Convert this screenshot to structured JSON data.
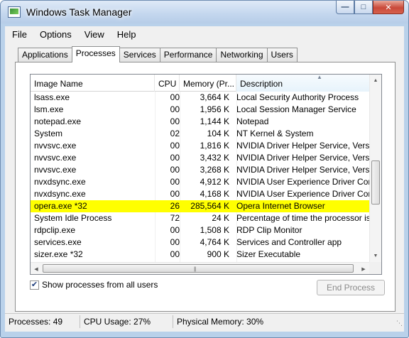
{
  "window": {
    "title": "Windows Task Manager"
  },
  "menu": [
    "File",
    "Options",
    "View",
    "Help"
  ],
  "tabs": [
    "Applications",
    "Processes",
    "Services",
    "Performance",
    "Networking",
    "Users"
  ],
  "active_tab": "Processes",
  "columns": {
    "image_name": "Image Name",
    "cpu": "CPU",
    "memory": "Memory (Pr...",
    "description": "Description"
  },
  "processes": [
    {
      "name": "lsass.exe",
      "cpu": "00",
      "memory": "3,664 K",
      "description": "Local Security Authority Process"
    },
    {
      "name": "lsm.exe",
      "cpu": "00",
      "memory": "1,956 K",
      "description": "Local Session Manager Service"
    },
    {
      "name": "notepad.exe",
      "cpu": "00",
      "memory": "1,144 K",
      "description": "Notepad"
    },
    {
      "name": "System",
      "cpu": "02",
      "memory": "104 K",
      "description": "NT Kernel & System"
    },
    {
      "name": "nvvsvc.exe",
      "cpu": "00",
      "memory": "1,816 K",
      "description": "NVIDIA Driver Helper Service, Version ..."
    },
    {
      "name": "nvvsvc.exe",
      "cpu": "00",
      "memory": "3,432 K",
      "description": "NVIDIA Driver Helper Service, Version ..."
    },
    {
      "name": "nvvsvc.exe",
      "cpu": "00",
      "memory": "3,268 K",
      "description": "NVIDIA Driver Helper Service, Version ..."
    },
    {
      "name": "nvxdsync.exe",
      "cpu": "00",
      "memory": "4,912 K",
      "description": "NVIDIA User Experience Driver Compo..."
    },
    {
      "name": "nvxdsync.exe",
      "cpu": "00",
      "memory": "4,168 K",
      "description": "NVIDIA User Experience Driver Compo..."
    },
    {
      "name": "opera.exe *32",
      "cpu": "26",
      "memory": "285,564 K",
      "description": "Opera Internet Browser",
      "highlight": true
    },
    {
      "name": "System Idle Process",
      "cpu": "72",
      "memory": "24 K",
      "description": "Percentage of time the processor is idle"
    },
    {
      "name": "rdpclip.exe",
      "cpu": "00",
      "memory": "1,508 K",
      "description": "RDP Clip Monitor"
    },
    {
      "name": "services.exe",
      "cpu": "00",
      "memory": "4,764 K",
      "description": "Services and Controller app"
    },
    {
      "name": "sizer.exe *32",
      "cpu": "00",
      "memory": "900 K",
      "description": "Sizer Executable"
    }
  ],
  "show_all_users": {
    "label": "Show processes from all users",
    "checked": true
  },
  "end_process_label": "End Process",
  "status": {
    "processes": "Processes: 49",
    "cpu_usage": "CPU Usage: 27%",
    "physical_memory": "Physical Memory: 30%"
  },
  "colors": {
    "highlight": "#ffff00",
    "frame": "#b9d1ea"
  }
}
